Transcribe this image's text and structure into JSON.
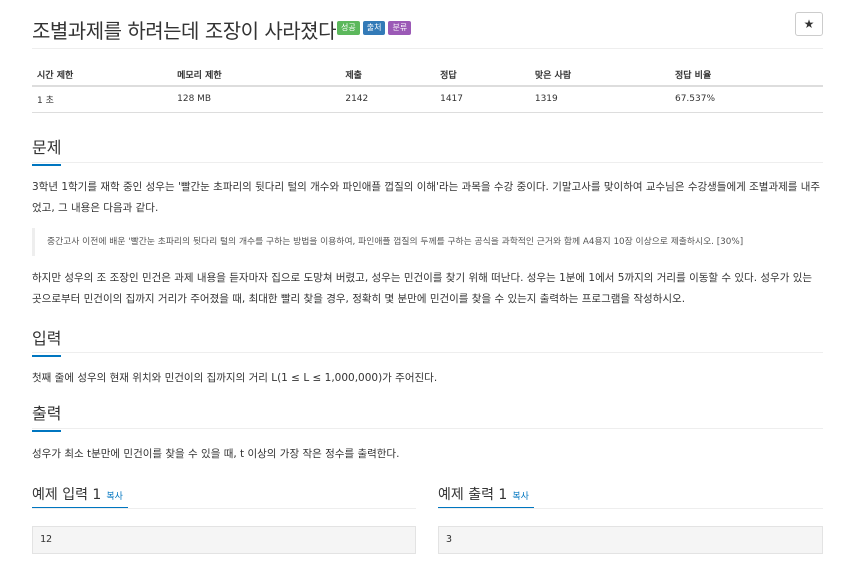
{
  "problem": {
    "title": "조별과제를 하려는데 조장이 사라졌다",
    "badges": [
      {
        "label": "성공",
        "color": "#5cb85c"
      },
      {
        "label": "출처",
        "color": "#337ab7"
      },
      {
        "label": "분류",
        "color": "#9b59b6"
      }
    ],
    "star_icon": "★"
  },
  "info_table": {
    "headers": [
      "시간 제한",
      "메모리 제한",
      "제출",
      "정답",
      "맞은 사람",
      "정답 비율"
    ],
    "values": [
      "1 초",
      "128 MB",
      "2142",
      "1417",
      "1319",
      "67.537%"
    ]
  },
  "sections": {
    "problem_heading": "문제",
    "problem_text_1": "3학년 1학기를 재학 중인 성우는 '빨간눈 초파리의 뒷다리 털의 개수와 파인애플 껍질의 이해'라는 과목을 수강 중이다. 기말고사를 맞이하여 교수님은 수강생들에게 조별과제를 내주었고, 그 내용은 다음과 같다.",
    "quote": "중간고사 이전에 배운 '빨간눈 초파리의 뒷다리 털의 개수를 구하는 방법을 이용하여, 파인애플 껍질의 두께를 구하는 공식을 과학적인 근거와 함께 A4용지 10장 이상으로 제출하시오. [30%]",
    "problem_text_2": "하지만 성우의 조 조장인 민건은 과제 내용을 듣자마자 집으로 도망쳐 버렸고, 성우는 민건이를 찾기 위해 떠난다. 성우는 1분에 1에서 5까지의 거리를 이동할 수 있다. 성우가 있는 곳으로부터 민건이의 집까지 거리가 주어졌을 때, 최대한 빨리 찾을 경우, 정확히 몇 분만에 민건이를 찾을 수 있는지 출력하는 프로그램을 작성하시오.",
    "input_heading": "입력",
    "input_text": "첫째 줄에 성우의 현재 위치와 민건이의 집까지의 거리 L(1 ≤ L ≤ 1,000,000)가 주어진다.",
    "output_heading": "출력",
    "output_text": "성우가 최소 t분만에 민건이를 찾을 수 있을 때, t 이상의 가장 작은 정수를 출력한다."
  },
  "examples": {
    "input_heading": "예제 입력 1",
    "output_heading": "예제 출력 1",
    "copy_label": "복사",
    "input_value": "12",
    "output_value": "3"
  }
}
